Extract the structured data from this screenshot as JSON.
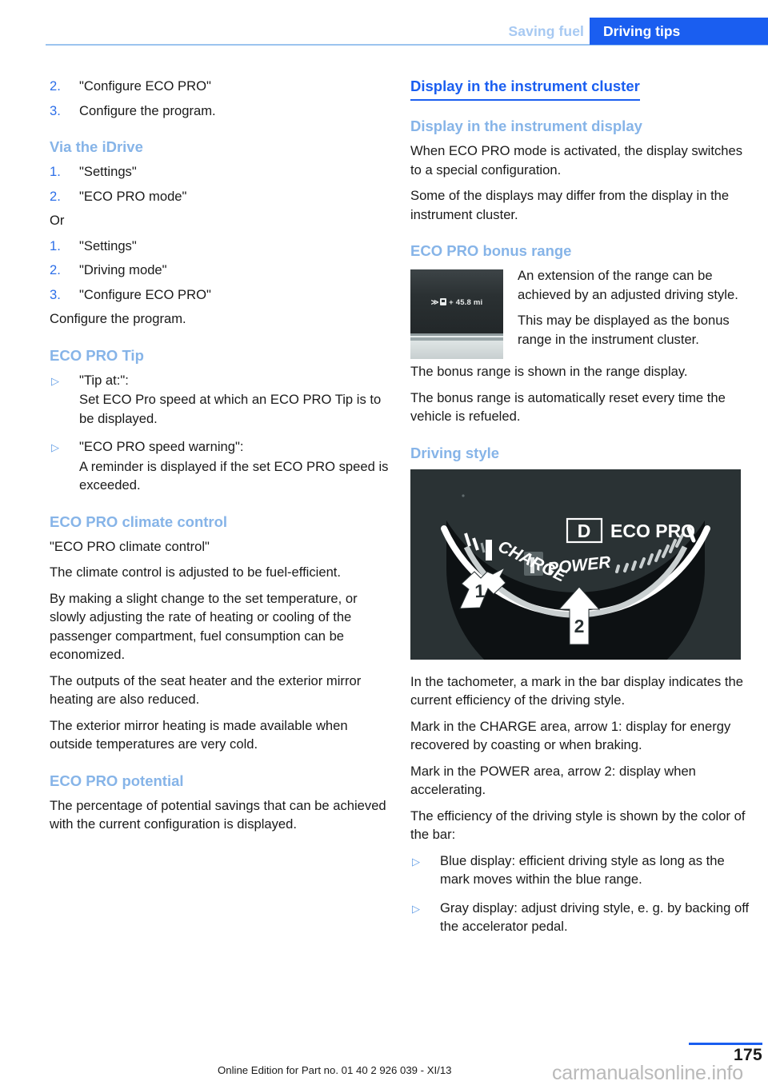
{
  "header": {
    "breadcrumb_previous": "Saving fuel",
    "breadcrumb_current": "Driving tips"
  },
  "left_column": {
    "steps_top": [
      {
        "num": "2.",
        "text": "\"Configure ECO PRO\""
      },
      {
        "num": "3.",
        "text": "Configure the program."
      }
    ],
    "via_idrive": {
      "heading": "Via the iDrive",
      "steps_a": [
        {
          "num": "1.",
          "text": "\"Settings\""
        },
        {
          "num": "2.",
          "text": "\"ECO PRO mode\""
        }
      ],
      "or_label": "Or",
      "steps_b": [
        {
          "num": "1.",
          "text": "\"Settings\""
        },
        {
          "num": "2.",
          "text": "\"Driving mode\""
        },
        {
          "num": "3.",
          "text": "\"Configure ECO PRO\""
        }
      ],
      "closing_line": "Configure the program."
    },
    "eco_pro_tip": {
      "heading": "ECO PRO Tip",
      "items": [
        {
          "label": "\"Tip at:\":",
          "body": "Set ECO Pro speed at which an ECO PRO Tip is to be displayed."
        },
        {
          "label": "\"ECO PRO speed warning\":",
          "body": "A reminder is displayed if the set ECO PRO speed is exceeded."
        }
      ]
    },
    "climate_control": {
      "heading": "ECO PRO climate control",
      "paragraphs": [
        "\"ECO PRO climate control\"",
        "The climate control is adjusted to be fuel-efficient.",
        "By making a slight change to the set temperature, or slowly adjusting the rate of heating or cooling of the passenger compartment, fuel consumption can be economized.",
        "The outputs of the seat heater and the exterior mirror heating are also reduced.",
        "The exterior mirror heating is made available when outside temperatures are very cold."
      ]
    },
    "potential": {
      "heading": "ECO PRO potential",
      "paragraphs": [
        "The percentage of potential savings that can be achieved with the current configuration is displayed."
      ]
    }
  },
  "right_column": {
    "section_title": "Display in the instrument cluster",
    "instrument_display": {
      "heading": "Display in the instrument display",
      "paragraphs": [
        "When ECO PRO mode is activated, the display switches to a special configuration.",
        "Some of the displays may differ from the display in the instrument cluster."
      ]
    },
    "bonus_range": {
      "heading": "ECO PRO bonus range",
      "figure": {
        "chevron": "≫",
        "icon_name": "fuel-pump-icon",
        "value": "+ 45.8 mi"
      },
      "wrapped_paragraph_a": "An extension of the range can be achieved by an adjusted driving style.",
      "wrapped_paragraph_b": "This may be displayed as the bonus range in the instrument cluster.",
      "paragraphs": [
        "The bonus range is shown in the range display.",
        "The bonus range is automatically reset every time the vehicle is refueled."
      ]
    },
    "driving_style": {
      "heading": "Driving style",
      "figure": {
        "gear_indicator": "D",
        "mode_label": "ECO PRO",
        "charge_label": "CHARGE",
        "power_label": "POWER",
        "arrow_1_label": "1",
        "arrow_2_label": "2"
      },
      "paragraphs": [
        "In the tachometer, a mark in the bar display indicates the current efficiency of the driving style.",
        "Mark in the CHARGE area, arrow 1: display for energy recovered by coasting or when braking.",
        "Mark in the POWER area, arrow 2: display when accelerating.",
        "The efficiency of the driving style is shown by the color of the bar:"
      ],
      "bullets": [
        "Blue display: efficient driving style as long as the mark moves within the blue range.",
        "Gray display: adjust driving style, e. g. by backing off the accelerator pedal."
      ]
    }
  },
  "footer": {
    "edition": "Online Edition for Part no. 01 40 2 926 039 - XI/13",
    "page_number": "175",
    "watermark": "carmanualsonline.info"
  },
  "colors": {
    "accent_blue": "#1a5ef0",
    "light_blue": "#86b4e8",
    "list_number_blue": "#2d6fe8",
    "figure_dark": "#2a3234"
  }
}
